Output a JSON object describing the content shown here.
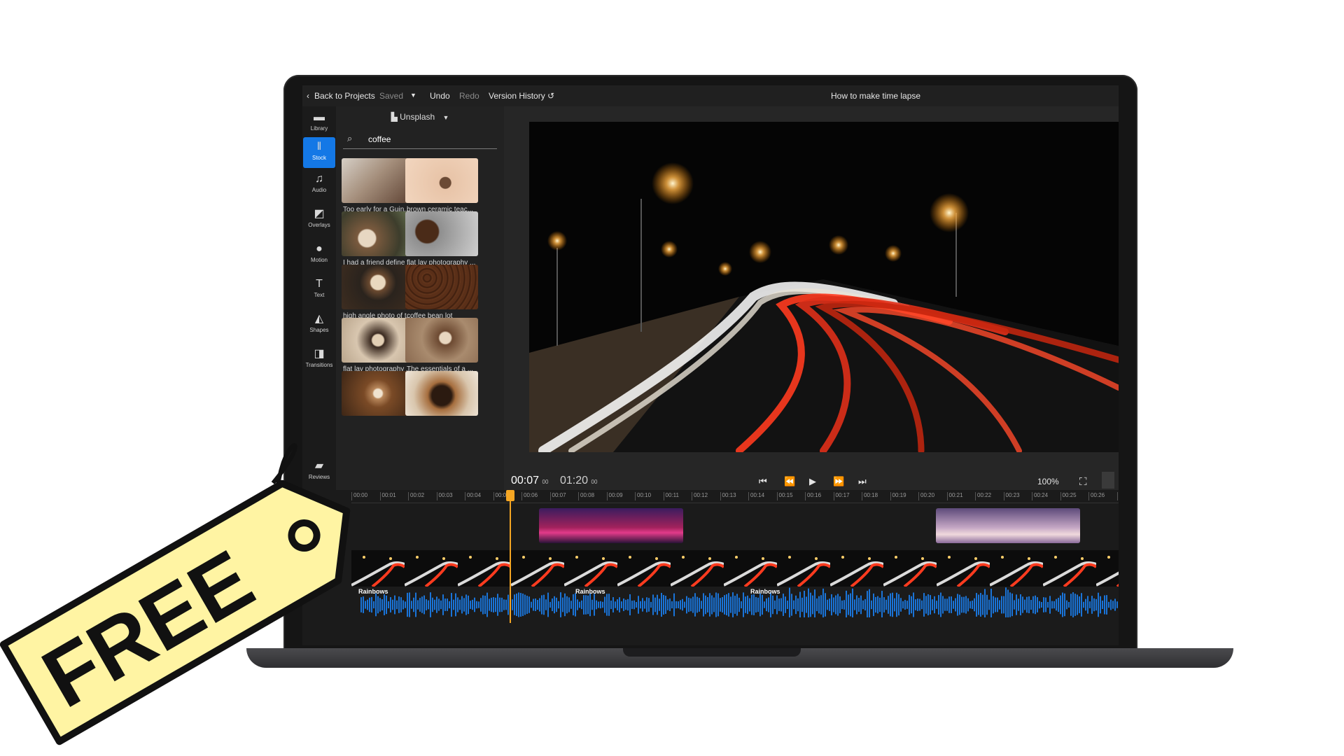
{
  "topbar": {
    "back_label": "Back to Projects",
    "saved_label": "Saved",
    "undo_label": "Undo",
    "redo_label": "Redo",
    "version_history_label": "Version History",
    "project_title": "How to make time lapse"
  },
  "rail": {
    "items": [
      {
        "label": "Library",
        "icon": "folder-icon"
      },
      {
        "label": "Stock",
        "icon": "books-icon"
      },
      {
        "label": "Audio",
        "icon": "music-note-icon"
      },
      {
        "label": "Overlays",
        "icon": "overlay-icon"
      },
      {
        "label": "Motion",
        "icon": "motion-icon"
      },
      {
        "label": "Text",
        "icon": "text-icon"
      },
      {
        "label": "Shapes",
        "icon": "shapes-icon"
      },
      {
        "label": "Transitions",
        "icon": "transitions-icon"
      },
      {
        "label": "Reviews",
        "icon": "chat-icon"
      }
    ],
    "active": "Stock"
  },
  "stock": {
    "source_label": "Unsplash",
    "search_value": "coffee",
    "results": [
      {
        "caption": "Too early for a Guin..."
      },
      {
        "caption": "brown ceramic teac..."
      },
      {
        "caption": "I had a friend define ..."
      },
      {
        "caption": "flat lay photography ..."
      },
      {
        "caption": "high angle photo of t..."
      },
      {
        "caption": "coffee bean lot"
      },
      {
        "caption": "flat lay photography ..."
      },
      {
        "caption": "The essentials of a ..."
      },
      {
        "caption": ""
      },
      {
        "caption": ""
      }
    ],
    "thumb_size_level": 0.4
  },
  "player": {
    "current_time": "00:07",
    "current_frames": "00",
    "total_time": "01:20",
    "total_frames": "00",
    "zoom": "100%"
  },
  "timeline": {
    "ruler_labels": [
      "00:00",
      "00:01",
      "00:02",
      "00:03",
      "00:04",
      "00:05",
      "00:06",
      "00:07",
      "00:08",
      "00:09",
      "00:10",
      "00:11",
      "00:12",
      "00:13",
      "00:14",
      "00:15",
      "00:16",
      "00:17",
      "00:18",
      "00:19",
      "00:20",
      "00:21",
      "00:22",
      "00:23",
      "00:24",
      "00:25",
      "00:26",
      "00:2"
    ],
    "audio_track_labels": [
      "Rainbows",
      "Rainbows",
      "Rainbows"
    ],
    "playhead_time": "00:07"
  },
  "tag": {
    "text": "FREE"
  },
  "colors": {
    "accent": "#1478e6",
    "playhead": "#f5a623",
    "waveform": "#1a74d8",
    "tag_fill": "#fff4a3"
  }
}
